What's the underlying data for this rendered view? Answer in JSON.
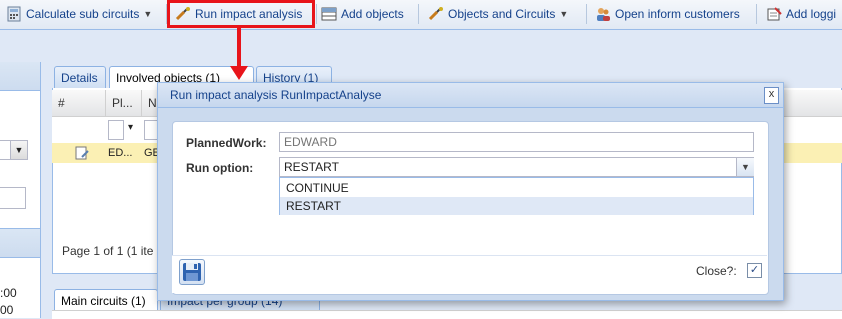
{
  "toolbar": {
    "calculate_sub_circuits": "Calculate sub circuits",
    "run_impact_analysis": "Run impact analysis",
    "add_objects": "Add objects",
    "objects_and_circuits": "Objects and Circuits",
    "open_inform_customers": "Open inform customers",
    "add_logging": "Add loggi"
  },
  "left_panel": {
    "time1": ":00",
    "time2": "00"
  },
  "main": {
    "tabs": [
      {
        "label": "Details"
      },
      {
        "label": "Involved objects (1)"
      },
      {
        "label": "History (1)"
      }
    ],
    "columns": [
      "#",
      "Pl...",
      "N"
    ],
    "row": {
      "c1": "ED...",
      "c2": "GE"
    },
    "paging": "Page 1 of 1 (1 ite"
  },
  "lower": {
    "tabs": [
      {
        "label": "Main circuits (1)"
      },
      {
        "label": "Impact per group (14)"
      }
    ]
  },
  "dialog": {
    "title": "Run impact analysis RunImpactAnalyse",
    "close_glyph": "x",
    "planned_work_label": "PlannedWork:",
    "planned_work_placeholder": "EDWARD",
    "run_option_label": "Run option:",
    "run_option_value": "RESTART",
    "options": [
      "CONTINUE",
      "RESTART"
    ],
    "selected_option": "RESTART",
    "close_label": "Close?:",
    "close_checked": true
  },
  "colors": {
    "annotation": "#e8141a",
    "toolbar_text": "#15428b"
  }
}
